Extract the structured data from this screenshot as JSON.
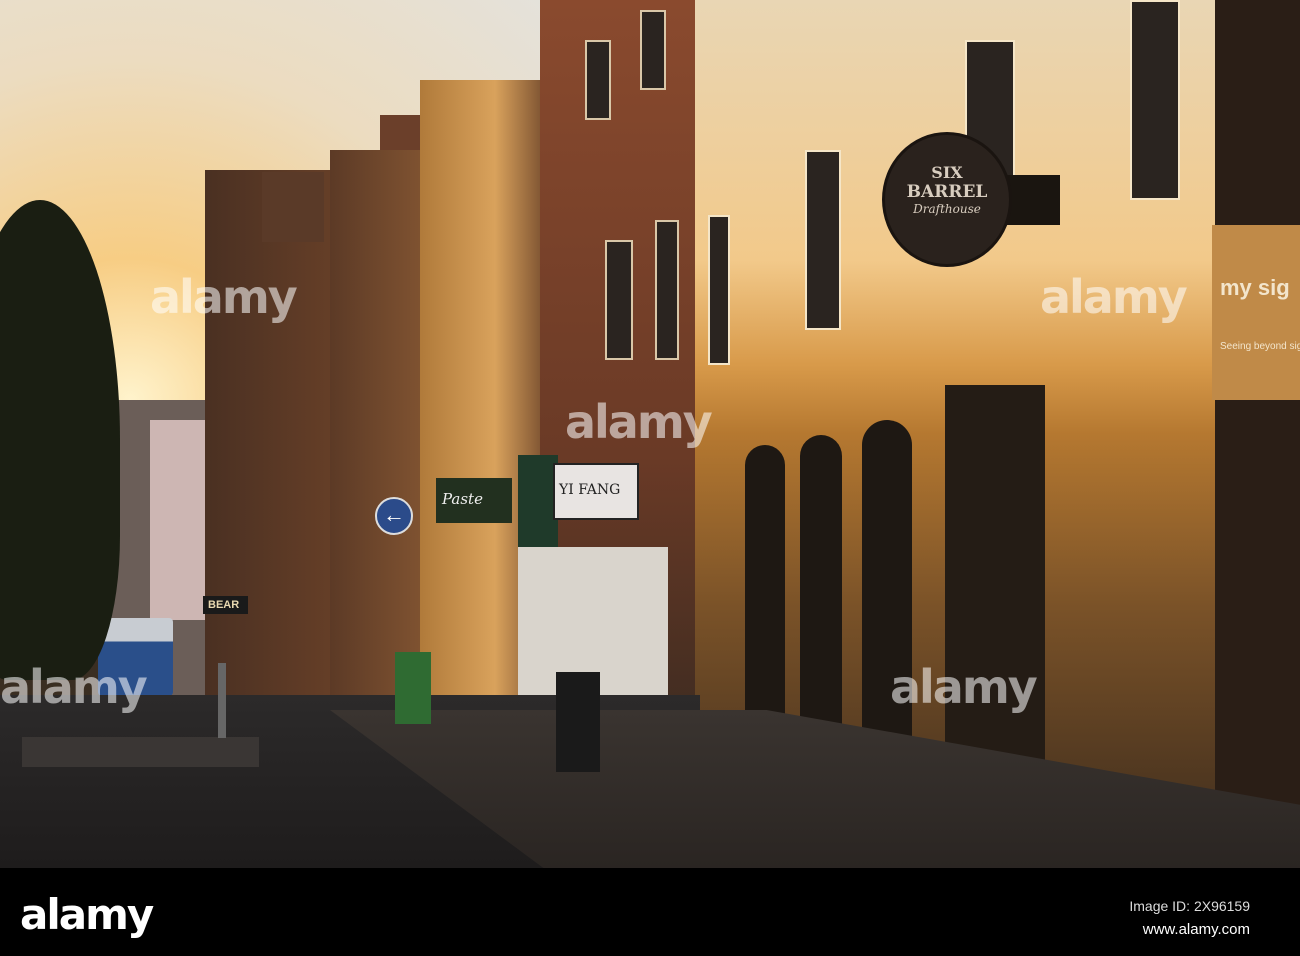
{
  "photo": {
    "signs": {
      "six_barrel_line1": "SIX",
      "six_barrel_line2": "BARREL",
      "six_barrel_line3": "Drafthouse",
      "my_sight": "my sig",
      "my_sight_tagline": "Seeing beyond sight",
      "paste": "Paste",
      "yi_fang": "YI FANG",
      "bear": "BEAR"
    },
    "watermark": "alamy"
  },
  "footer": {
    "logo": "alamy",
    "image_id": "Image ID: 2X96159",
    "website": "www.alamy.com"
  },
  "colors": {
    "sunlight": "#f0b45a",
    "shadow": "#2a221b",
    "bar": "#000000"
  }
}
